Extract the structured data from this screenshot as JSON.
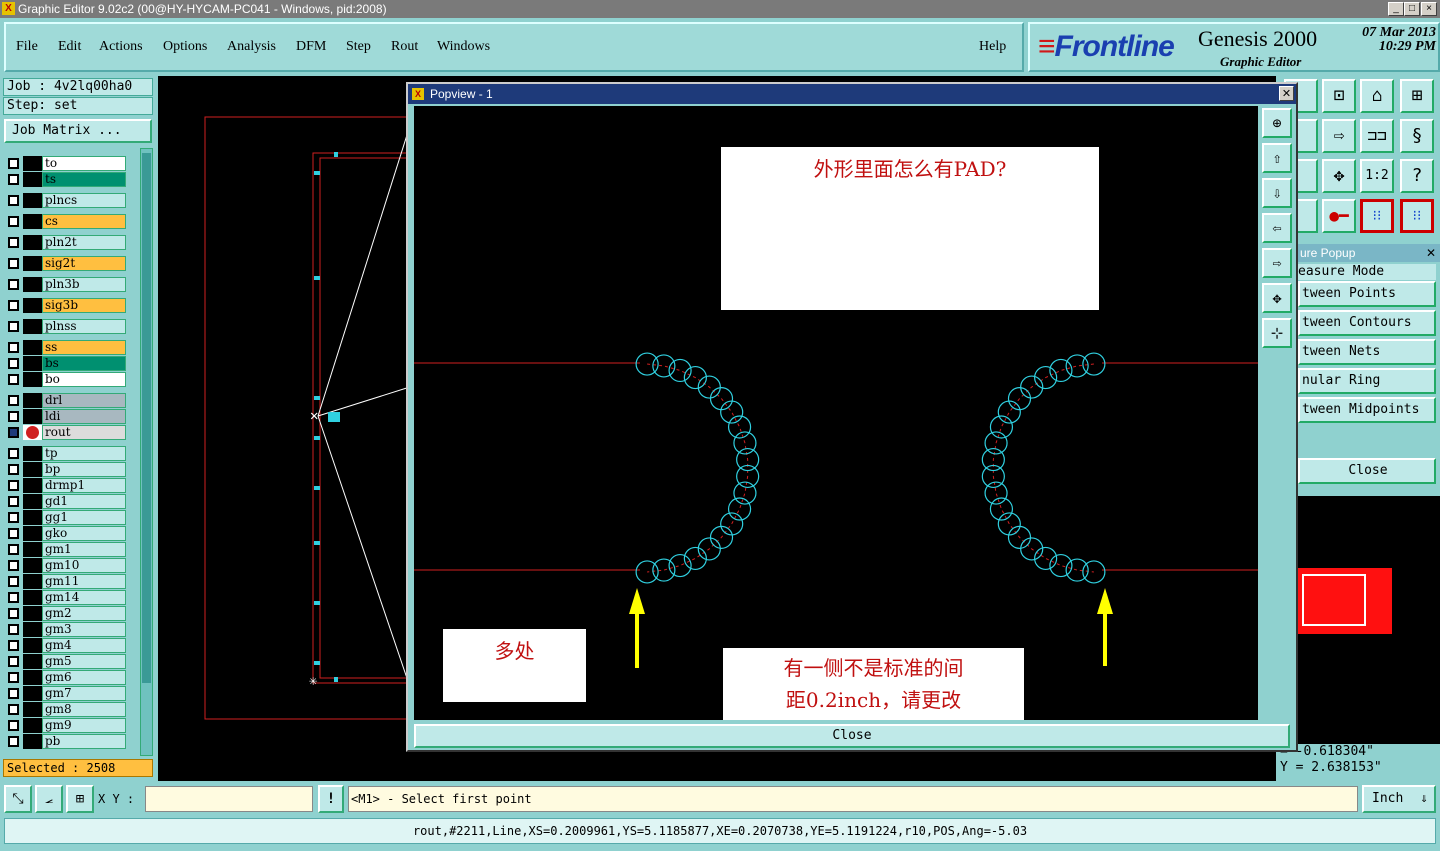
{
  "window": {
    "title": "Graphic Editor 9.02c2 (00@HY-HYCAM-PC041 - Windows, pid:2008)",
    "minimize": "_",
    "maximize": "□",
    "close": "×"
  },
  "menu": {
    "file": "File",
    "edit": "Edit",
    "actions": "Actions",
    "options": "Options",
    "analysis": "Analysis",
    "dfm": "DFM",
    "step": "Step",
    "rout": "Rout",
    "windows": "Windows",
    "help": "Help"
  },
  "brand": {
    "logo": "Frontline",
    "product": "Genesis 2000",
    "subtitle": "Graphic Editor",
    "date": "07 Mar 2013",
    "time": "10:29 PM"
  },
  "job": {
    "job_label": "Job : 4v2lq00ha0",
    "step_label": "Step: set",
    "matrix_button": "Job Matrix ..."
  },
  "layers": [
    {
      "name": "to",
      "color": "#ffffff"
    },
    {
      "name": "ts",
      "color": "#009070"
    },
    {
      "name": "plncs",
      "color": "#bfe9e8"
    },
    {
      "name": "cs",
      "color": "#ffbf40"
    },
    {
      "name": "pln2t",
      "color": "#bfe9e8"
    },
    {
      "name": "sig2t",
      "color": "#ffbf40"
    },
    {
      "name": "pln3b",
      "color": "#bfe9e8"
    },
    {
      "name": "sig3b",
      "color": "#ffbf40"
    },
    {
      "name": "plnss",
      "color": "#bfe9e8"
    },
    {
      "name": "ss",
      "color": "#ffbf40"
    },
    {
      "name": "bs",
      "color": "#009070"
    },
    {
      "name": "bo",
      "color": "#ffffff"
    },
    {
      "name": "drl",
      "color": "#a8b8c0"
    },
    {
      "name": "ldi",
      "color": "#a8b8c0"
    },
    {
      "name": "rout",
      "color": "#dcdcdc"
    },
    {
      "name": "tp",
      "color": "#bfe9e8"
    },
    {
      "name": "bp",
      "color": "#bfe9e8"
    },
    {
      "name": "drmp1",
      "color": "#bfe9e8"
    },
    {
      "name": "gd1",
      "color": "#bfe9e8"
    },
    {
      "name": "gg1",
      "color": "#bfe9e8"
    },
    {
      "name": "gko",
      "color": "#bfe9e8"
    },
    {
      "name": "gm1",
      "color": "#bfe9e8"
    },
    {
      "name": "gm10",
      "color": "#bfe9e8"
    },
    {
      "name": "gm11",
      "color": "#bfe9e8"
    },
    {
      "name": "gm14",
      "color": "#bfe9e8"
    },
    {
      "name": "gm2",
      "color": "#bfe9e8"
    },
    {
      "name": "gm3",
      "color": "#bfe9e8"
    },
    {
      "name": "gm4",
      "color": "#bfe9e8"
    },
    {
      "name": "gm5",
      "color": "#bfe9e8"
    },
    {
      "name": "gm6",
      "color": "#bfe9e8"
    },
    {
      "name": "gm7",
      "color": "#bfe9e8"
    },
    {
      "name": "gm8",
      "color": "#bfe9e8"
    },
    {
      "name": "gm9",
      "color": "#bfe9e8"
    },
    {
      "name": "pb",
      "color": "#bfe9e8"
    }
  ],
  "selected": "Selected : 2508",
  "popview": {
    "title": "Popview - 1",
    "note_top": "外形里面怎么有PAD?",
    "note_left": "多处",
    "note_bottom_line1": "有一侧不是标准的间",
    "note_bottom_line2": "距0.2inch，请更改",
    "close": "Close"
  },
  "measure": {
    "title": "ure Popup",
    "mode": "easure Mode",
    "items": [
      "tween Points",
      "tween Contours",
      "tween Nets",
      "nular Ring",
      "tween Midpoints"
    ],
    "close": "Close"
  },
  "coords": {
    "x": "= -0.618304\"",
    "y": "Y = 2.638153\""
  },
  "status": {
    "xy_label": "X Y :",
    "xy_value": "",
    "warn": "!",
    "prompt": "<M1> - Select first point",
    "units": "Inch"
  },
  "feature_info": "rout,#2211,Line,XS=0.2009961,YS=5.1185877,XE=0.2070738,YE=5.1191224,r10,POS,Ang=-5.03",
  "colors": {
    "accent": "#8fd1cf",
    "popup_title": "#1e3a7a",
    "note_text": "#c01010",
    "rout_line": "#d02020",
    "pad_outline": "#30d0e0",
    "arrow": "#ffff00"
  }
}
